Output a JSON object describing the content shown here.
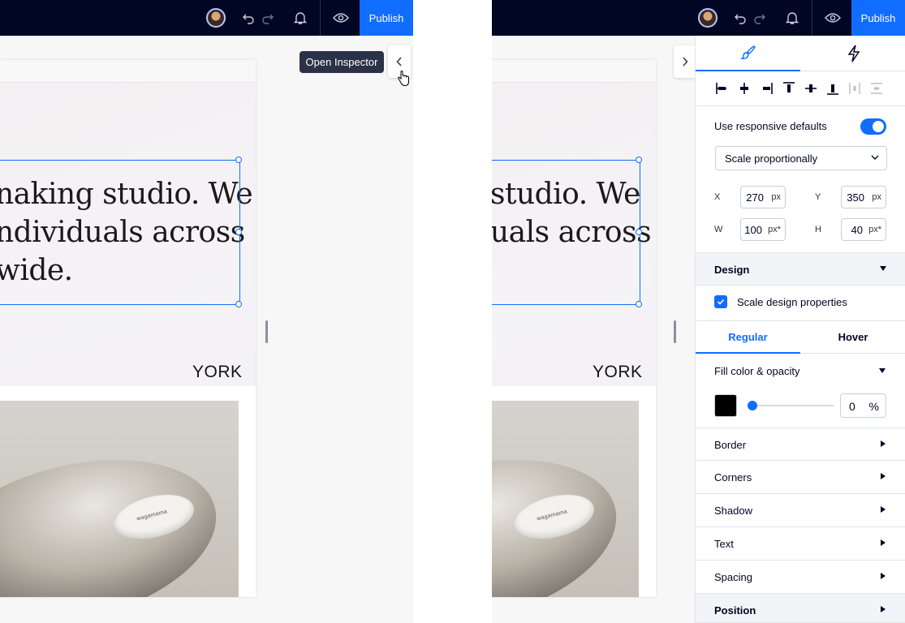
{
  "topbar": {
    "publish_label": "Publish"
  },
  "left_pane": {
    "tooltip": "Open Inspector",
    "hero_lines": [
      "naking studio. We",
      "ndividuals across",
      "wide."
    ],
    "york": "YORK",
    "bowl_brand": "wagamama"
  },
  "right_pane": {
    "hero_lines": [
      "studio. We",
      "uals across"
    ],
    "york": "YORK",
    "bowl_brand": "wagamama"
  },
  "inspector": {
    "tabs": [
      {
        "icon": "paintbrush-icon"
      },
      {
        "icon": "lightning-icon"
      }
    ],
    "align_icons": [
      "align-left-icon",
      "align-center-icon",
      "align-right-icon",
      "align-top-icon",
      "align-middle-icon",
      "align-bottom-icon",
      "distribute-horizontal-icon",
      "distribute-vertical-icon"
    ],
    "responsive_label": "Use responsive defaults",
    "responsive_on": true,
    "scale_dropdown": "Scale proportionally",
    "x_label": "X",
    "x_value": "270",
    "x_unit": "px",
    "y_label": "Y",
    "y_value": "350",
    "y_unit": "px",
    "w_label": "W",
    "w_value": "100",
    "w_unit": "px*",
    "h_label": "H",
    "h_value": "40",
    "h_unit": "px*",
    "design_label": "Design",
    "scale_design_label": "Scale design properties",
    "state_tabs": [
      "Regular",
      "Hover"
    ],
    "fill_label": "Fill color & opacity",
    "fill_color": "#000000",
    "opacity_value": "0",
    "opacity_unit": "%",
    "sections": [
      "Border",
      "Corners",
      "Shadow",
      "Text",
      "Spacing"
    ],
    "position_label": "Position"
  },
  "colors": {
    "accent": "#116dff",
    "topbar": "#000624"
  }
}
